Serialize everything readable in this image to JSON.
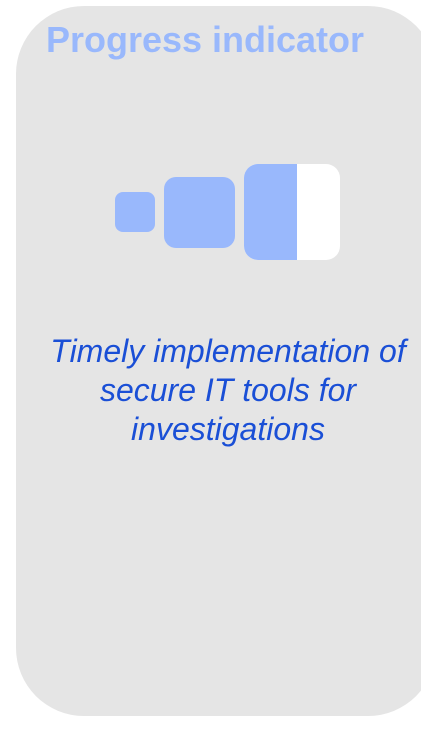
{
  "card": {
    "title": "Progress indicator",
    "description": "Timely implementation of secure IT tools for investigations"
  },
  "progress": {
    "steps_total": 3,
    "current_step_fill_fraction": 0.55
  },
  "colors": {
    "card_background": "#e5e5e5",
    "accent": "#99b8fc",
    "description_text": "#1a4fd6",
    "unfilled": "#ffffff"
  },
  "icons": {
    "progress": "progress-steps-icon"
  }
}
